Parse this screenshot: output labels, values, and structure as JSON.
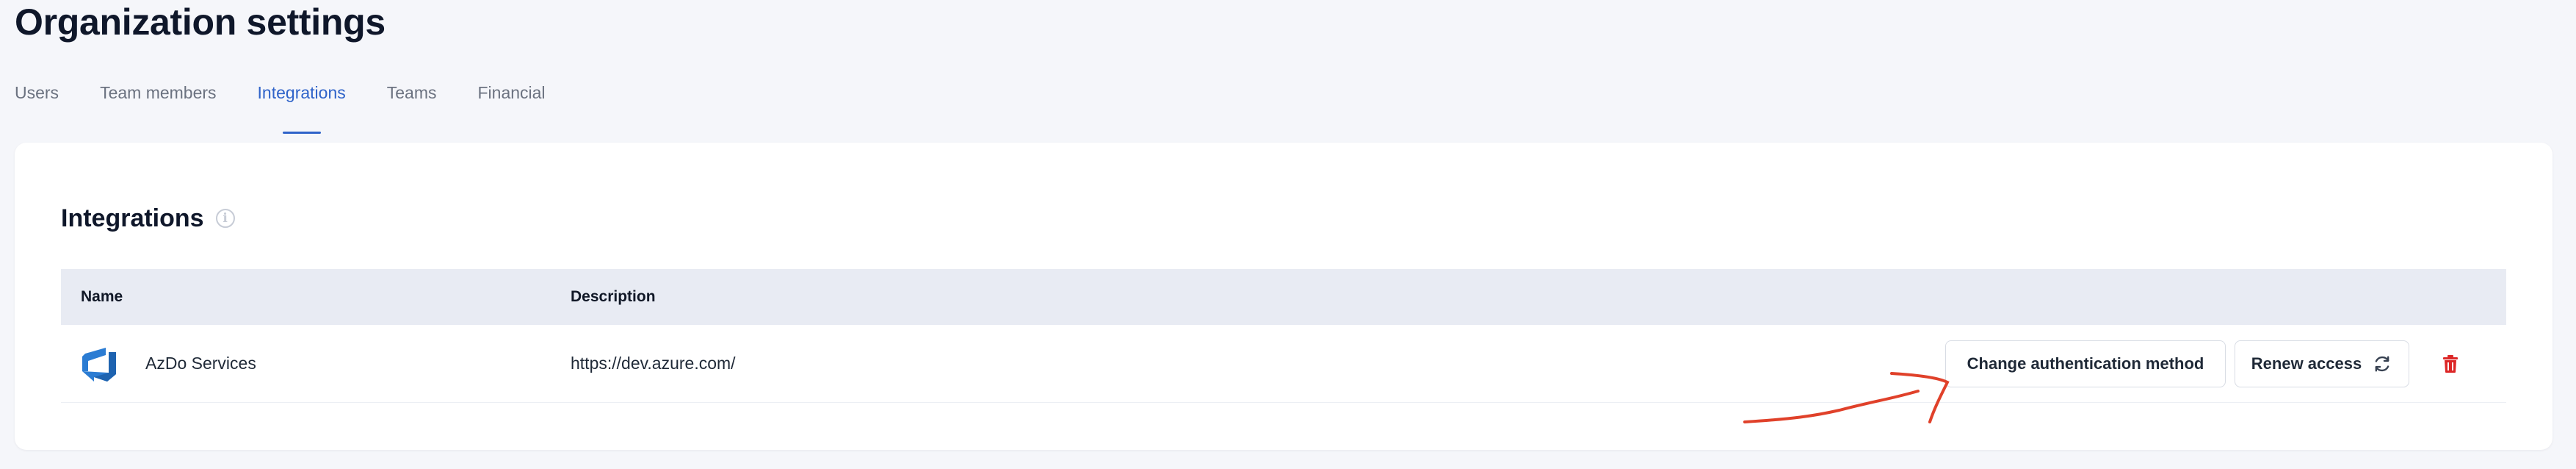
{
  "page": {
    "title": "Organization settings"
  },
  "tabs": [
    {
      "label": "Users",
      "active": false
    },
    {
      "label": "Team members",
      "active": false
    },
    {
      "label": "Integrations",
      "active": true
    },
    {
      "label": "Teams",
      "active": false
    },
    {
      "label": "Financial",
      "active": false
    }
  ],
  "section": {
    "title": "Integrations",
    "info_icon": "info-icon"
  },
  "table": {
    "headers": {
      "name": "Name",
      "description": "Description"
    },
    "rows": [
      {
        "name": "AzDo Services",
        "description": "https://dev.azure.com/",
        "icon": "azure-devops-icon",
        "actions": {
          "change_auth": "Change authentication method",
          "renew": "Renew access",
          "renew_icon": "refresh-icon",
          "delete_icon": "trash-icon"
        }
      }
    ]
  },
  "colors": {
    "accent": "#2f63c9",
    "danger": "#dc2626",
    "annotation": "#e0412a",
    "azure": "#2b7cd3"
  }
}
